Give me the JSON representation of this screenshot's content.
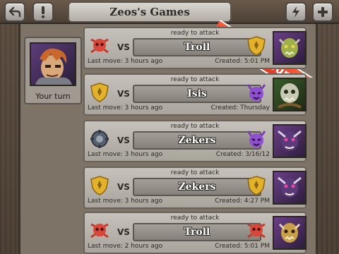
{
  "header": {
    "title": "Zeos's Games",
    "ribbon": "Play your friends!",
    "back_icon": "back-arrow-icon",
    "info_icon": "exclamation-icon",
    "sound_icon": "lightning-icon",
    "add_icon": "plus-icon"
  },
  "player": {
    "turn_label": "Your turn"
  },
  "games": [
    {
      "status": "ready to attack",
      "vs": "VS",
      "opponent": "Troll",
      "last_move": "Last move: 3 hours ago",
      "created": "Created: 5:01 PM",
      "left_emblem": "skull-emblem",
      "right_emblem": "gold-shield-emblem"
    },
    {
      "status": "ready to attack",
      "vs": "VS",
      "opponent": "Isis",
      "last_move": "Last move: 3 hours ago",
      "created": "Created: Thursday",
      "left_emblem": "gold-shield-emblem",
      "right_emblem": "purple-demon-emblem"
    },
    {
      "status": "ready to attack",
      "vs": "VS",
      "opponent": "Zekers",
      "last_move": "Last move: 3 hours ago",
      "created": "Created: 3/16/12",
      "left_emblem": "gear-emblem",
      "right_emblem": "purple-demon-emblem"
    },
    {
      "status": "ready to attack",
      "vs": "VS",
      "opponent": "Zekers",
      "last_move": "Last move: 3 hours ago",
      "created": "Created: 4:27 PM",
      "left_emblem": "gold-shield-emblem",
      "right_emblem": "gold-shield-emblem"
    },
    {
      "status": "ready to attack",
      "vs": "VS",
      "opponent": "Troll",
      "last_move": "Last move: 2 hours ago",
      "created": "Created: 5:01 PM",
      "left_emblem": "skull-emblem",
      "right_emblem": "skull-emblem"
    }
  ],
  "colors": {
    "ribbon": "#e13a22",
    "panel": "#7d7366",
    "plate": "#c6c2bb"
  }
}
